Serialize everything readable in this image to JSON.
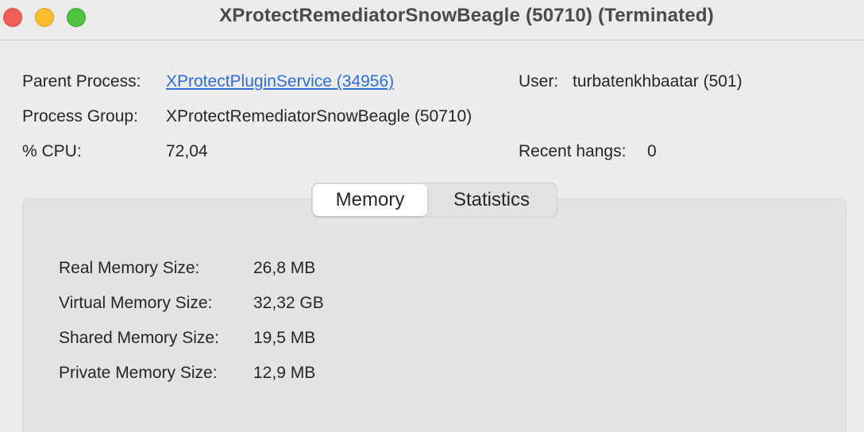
{
  "window": {
    "title": "XProtectRemediatorSnowBeagle (50710) (Terminated)"
  },
  "info": {
    "parent_process_label": "Parent Process:",
    "parent_process_value": "XProtectPluginService (34956)",
    "user_label": "User:",
    "user_value": "turbatenkhbaatar (501)",
    "process_group_label": "Process Group:",
    "process_group_value": "XProtectRemediatorSnowBeagle (50710)",
    "cpu_label": "% CPU:",
    "cpu_value": "72,04",
    "recent_hangs_label": "Recent hangs:",
    "recent_hangs_value": "0"
  },
  "tabs": [
    {
      "label": "Memory",
      "selected": true
    },
    {
      "label": "Statistics",
      "selected": false
    }
  ],
  "memory": [
    {
      "label": "Real Memory Size:",
      "value": "26,8 MB"
    },
    {
      "label": "Virtual Memory Size:",
      "value": "32,32 GB"
    },
    {
      "label": "Shared Memory Size:",
      "value": "19,5 MB"
    },
    {
      "label": "Private Memory Size:",
      "value": "12,9 MB"
    }
  ]
}
